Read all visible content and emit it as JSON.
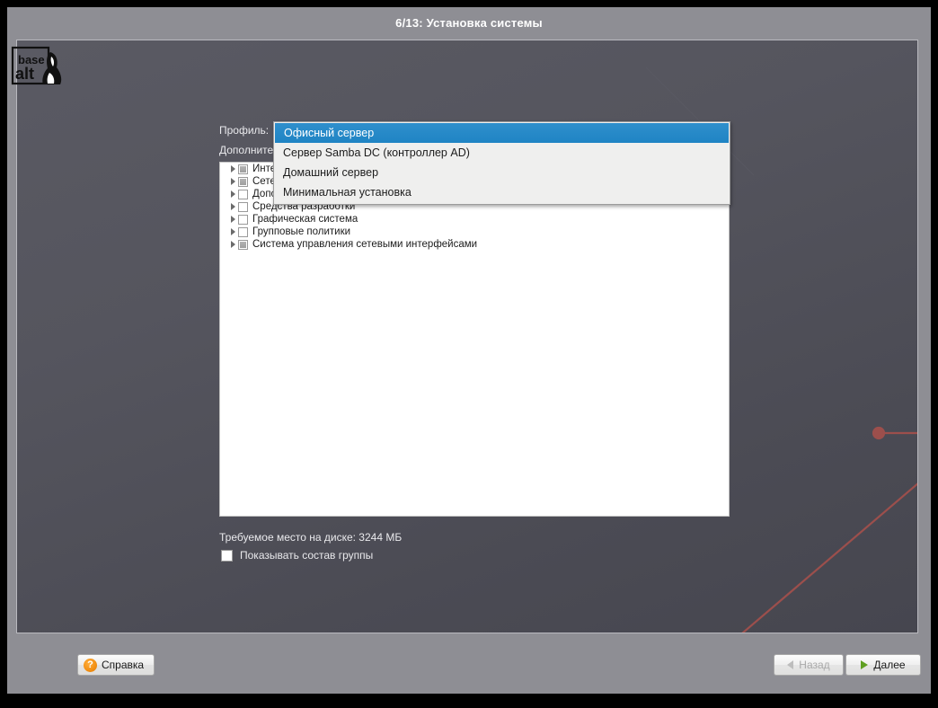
{
  "window": {
    "title": "6/13: Установка системы"
  },
  "form": {
    "profile_label": "Профиль:",
    "extra_label": "Дополнительные пакеты:",
    "disk_space": "Требуемое место на диске: 3244 МБ",
    "show_contents_label": "Показывать состав группы"
  },
  "profile_dropdown": {
    "expanded": true,
    "selected": "Офисный сервер",
    "options": [
      "Офисный сервер",
      "Сервер Samba DC (контроллер AD)",
      "Домашний сервер",
      "Минимальная установка"
    ]
  },
  "group_list": {
    "rows": [
      {
        "label": "Интернет-сервисы",
        "check": "partial"
      },
      {
        "label": "Сетевые службы",
        "check": "partial"
      },
      {
        "label": "Дополнительные сетевые службы",
        "check": "empty"
      },
      {
        "label": "Средства разработки",
        "check": "empty"
      },
      {
        "label": "Графическая система",
        "check": "empty"
      },
      {
        "label": "Групповые политики",
        "check": "empty"
      },
      {
        "label": "Система управления сетевыми интерфейсами",
        "check": "partial"
      }
    ]
  },
  "bottom_bar": {
    "logo_line1": "base",
    "logo_line2": "alt",
    "help_label": "Справка",
    "help_icon_glyph": "?",
    "back_label": "Назад",
    "next_label": "Далее"
  },
  "colors": {
    "titlebar": "#8e8e94",
    "panel_bg": "#52525c",
    "accent_selection": "#1f84c4",
    "help_orange": "#f08c10",
    "next_arrow_green": "#5f9f22",
    "deco_line": "#9c4f4c"
  }
}
